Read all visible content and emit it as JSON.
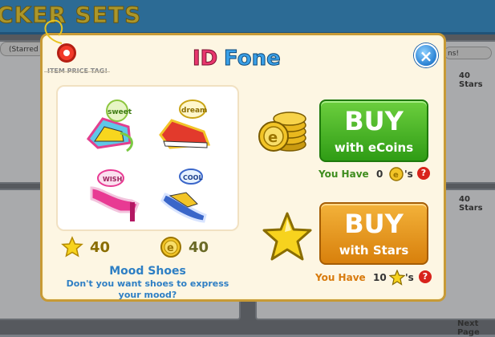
{
  "background": {
    "title": "CKER SETS",
    "filter_left": "(Starred",
    "filter_right": "ns!",
    "stars_label_top": "40 Stars",
    "stars_label_mid": "40 Stars",
    "next_page": "Next Page"
  },
  "dialog": {
    "logo_text": "IDFone",
    "close_symbol": "×",
    "price_tag_label": "ITEM PRICE TAG!",
    "stickers": [
      {
        "name": "sweet",
        "label": "sweet"
      },
      {
        "name": "dream",
        "label": "dream"
      },
      {
        "name": "wish",
        "label": "WISH"
      },
      {
        "name": "cool",
        "label": "COOL"
      }
    ],
    "star_price": "40",
    "coin_price": "40",
    "item_name": "Mood Shoes",
    "item_description": "Don't you want shoes to express your mood?",
    "buy_ecoins": {
      "big": "BUY",
      "small": "with eCoins"
    },
    "buy_stars": {
      "big": "BUY",
      "small": "with Stars"
    },
    "you_have_coins": {
      "label": "You Have",
      "value": "0",
      "suffix": "'s"
    },
    "you_have_stars": {
      "label": "You Have",
      "value": "10",
      "suffix": "'s"
    },
    "help_symbol": "?",
    "colors": {
      "green_button": "#2f9c15",
      "orange_button": "#d8800c",
      "item_text": "#2e7fc4",
      "frame": "#c79a36"
    }
  }
}
